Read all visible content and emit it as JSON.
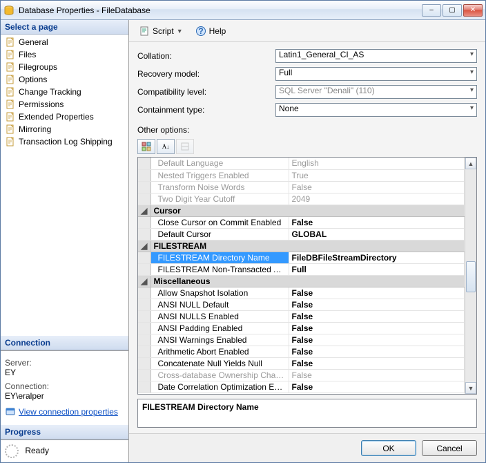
{
  "window": {
    "title": "Database Properties - FileDatabase"
  },
  "winbtns": {
    "min": "–",
    "max": "▢",
    "close": "✕"
  },
  "sidebar": {
    "header": "Select a page",
    "items": [
      {
        "label": "General"
      },
      {
        "label": "Files"
      },
      {
        "label": "Filegroups"
      },
      {
        "label": "Options"
      },
      {
        "label": "Change Tracking"
      },
      {
        "label": "Permissions"
      },
      {
        "label": "Extended Properties"
      },
      {
        "label": "Mirroring"
      },
      {
        "label": "Transaction Log Shipping"
      }
    ]
  },
  "connection": {
    "header": "Connection",
    "server_label": "Server:",
    "server": "EY",
    "conn_label": "Connection:",
    "conn": "EY\\eralper",
    "link": "View connection properties"
  },
  "progress": {
    "header": "Progress",
    "status": "Ready"
  },
  "toolbar": {
    "script": "Script",
    "help": "Help"
  },
  "form": {
    "collation": {
      "label": "Collation:",
      "value": "Latin1_General_CI_AS"
    },
    "recovery": {
      "label": "Recovery model:",
      "value": "Full"
    },
    "compat": {
      "label": "Compatibility level:",
      "value": "SQL Server \"Denali\" (110)"
    },
    "contain": {
      "label": "Containment type:",
      "value": "None"
    },
    "other": "Other options:"
  },
  "grid": {
    "rows": [
      {
        "t": "p",
        "dim": true,
        "name": "Default Language",
        "val": "English"
      },
      {
        "t": "p",
        "dim": true,
        "name": "Nested Triggers Enabled",
        "val": "True"
      },
      {
        "t": "p",
        "dim": true,
        "name": "Transform Noise Words",
        "val": "False"
      },
      {
        "t": "p",
        "dim": true,
        "name": "Two Digit Year Cutoff",
        "val": "2049"
      },
      {
        "t": "c",
        "name": "Cursor"
      },
      {
        "t": "p",
        "name": "Close Cursor on Commit Enabled",
        "val": "False"
      },
      {
        "t": "p",
        "name": "Default Cursor",
        "val": "GLOBAL"
      },
      {
        "t": "c",
        "name": "FILESTREAM"
      },
      {
        "t": "p",
        "sel": true,
        "name": "FILESTREAM Directory Name",
        "val": "FileDBFileStreamDirectory"
      },
      {
        "t": "p",
        "name": "FILESTREAM Non-Transacted Access",
        "val": "Full"
      },
      {
        "t": "c",
        "name": "Miscellaneous"
      },
      {
        "t": "p",
        "name": "Allow Snapshot Isolation",
        "val": "False"
      },
      {
        "t": "p",
        "name": "ANSI NULL Default",
        "val": "False"
      },
      {
        "t": "p",
        "name": "ANSI NULLS Enabled",
        "val": "False"
      },
      {
        "t": "p",
        "name": "ANSI Padding Enabled",
        "val": "False"
      },
      {
        "t": "p",
        "name": "ANSI Warnings Enabled",
        "val": "False"
      },
      {
        "t": "p",
        "name": "Arithmetic Abort Enabled",
        "val": "False"
      },
      {
        "t": "p",
        "name": "Concatenate Null Yields Null",
        "val": "False"
      },
      {
        "t": "p",
        "dim": true,
        "name": "Cross-database Ownership Chaining Enabled",
        "val": "False"
      },
      {
        "t": "p",
        "name": "Date Correlation Optimization Enabled",
        "val": "False"
      }
    ],
    "description": "FILESTREAM Directory Name"
  },
  "footer": {
    "ok": "OK",
    "cancel": "Cancel"
  }
}
